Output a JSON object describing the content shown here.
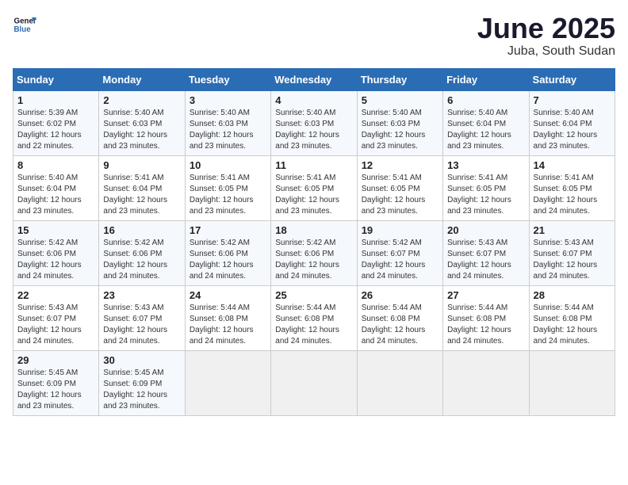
{
  "logo": {
    "line1": "General",
    "line2": "Blue"
  },
  "title": "June 2025",
  "location": "Juba, South Sudan",
  "weekdays": [
    "Sunday",
    "Monday",
    "Tuesday",
    "Wednesday",
    "Thursday",
    "Friday",
    "Saturday"
  ],
  "weeks": [
    [
      {
        "day": "1",
        "info": "Sunrise: 5:39 AM\nSunset: 6:02 PM\nDaylight: 12 hours\nand 22 minutes."
      },
      {
        "day": "2",
        "info": "Sunrise: 5:40 AM\nSunset: 6:03 PM\nDaylight: 12 hours\nand 23 minutes."
      },
      {
        "day": "3",
        "info": "Sunrise: 5:40 AM\nSunset: 6:03 PM\nDaylight: 12 hours\nand 23 minutes."
      },
      {
        "day": "4",
        "info": "Sunrise: 5:40 AM\nSunset: 6:03 PM\nDaylight: 12 hours\nand 23 minutes."
      },
      {
        "day": "5",
        "info": "Sunrise: 5:40 AM\nSunset: 6:03 PM\nDaylight: 12 hours\nand 23 minutes."
      },
      {
        "day": "6",
        "info": "Sunrise: 5:40 AM\nSunset: 6:04 PM\nDaylight: 12 hours\nand 23 minutes."
      },
      {
        "day": "7",
        "info": "Sunrise: 5:40 AM\nSunset: 6:04 PM\nDaylight: 12 hours\nand 23 minutes."
      }
    ],
    [
      {
        "day": "8",
        "info": "Sunrise: 5:40 AM\nSunset: 6:04 PM\nDaylight: 12 hours\nand 23 minutes."
      },
      {
        "day": "9",
        "info": "Sunrise: 5:41 AM\nSunset: 6:04 PM\nDaylight: 12 hours\nand 23 minutes."
      },
      {
        "day": "10",
        "info": "Sunrise: 5:41 AM\nSunset: 6:05 PM\nDaylight: 12 hours\nand 23 minutes."
      },
      {
        "day": "11",
        "info": "Sunrise: 5:41 AM\nSunset: 6:05 PM\nDaylight: 12 hours\nand 23 minutes."
      },
      {
        "day": "12",
        "info": "Sunrise: 5:41 AM\nSunset: 6:05 PM\nDaylight: 12 hours\nand 23 minutes."
      },
      {
        "day": "13",
        "info": "Sunrise: 5:41 AM\nSunset: 6:05 PM\nDaylight: 12 hours\nand 23 minutes."
      },
      {
        "day": "14",
        "info": "Sunrise: 5:41 AM\nSunset: 6:05 PM\nDaylight: 12 hours\nand 24 minutes."
      }
    ],
    [
      {
        "day": "15",
        "info": "Sunrise: 5:42 AM\nSunset: 6:06 PM\nDaylight: 12 hours\nand 24 minutes."
      },
      {
        "day": "16",
        "info": "Sunrise: 5:42 AM\nSunset: 6:06 PM\nDaylight: 12 hours\nand 24 minutes."
      },
      {
        "day": "17",
        "info": "Sunrise: 5:42 AM\nSunset: 6:06 PM\nDaylight: 12 hours\nand 24 minutes."
      },
      {
        "day": "18",
        "info": "Sunrise: 5:42 AM\nSunset: 6:06 PM\nDaylight: 12 hours\nand 24 minutes."
      },
      {
        "day": "19",
        "info": "Sunrise: 5:42 AM\nSunset: 6:07 PM\nDaylight: 12 hours\nand 24 minutes."
      },
      {
        "day": "20",
        "info": "Sunrise: 5:43 AM\nSunset: 6:07 PM\nDaylight: 12 hours\nand 24 minutes."
      },
      {
        "day": "21",
        "info": "Sunrise: 5:43 AM\nSunset: 6:07 PM\nDaylight: 12 hours\nand 24 minutes."
      }
    ],
    [
      {
        "day": "22",
        "info": "Sunrise: 5:43 AM\nSunset: 6:07 PM\nDaylight: 12 hours\nand 24 minutes."
      },
      {
        "day": "23",
        "info": "Sunrise: 5:43 AM\nSunset: 6:07 PM\nDaylight: 12 hours\nand 24 minutes."
      },
      {
        "day": "24",
        "info": "Sunrise: 5:44 AM\nSunset: 6:08 PM\nDaylight: 12 hours\nand 24 minutes."
      },
      {
        "day": "25",
        "info": "Sunrise: 5:44 AM\nSunset: 6:08 PM\nDaylight: 12 hours\nand 24 minutes."
      },
      {
        "day": "26",
        "info": "Sunrise: 5:44 AM\nSunset: 6:08 PM\nDaylight: 12 hours\nand 24 minutes."
      },
      {
        "day": "27",
        "info": "Sunrise: 5:44 AM\nSunset: 6:08 PM\nDaylight: 12 hours\nand 24 minutes."
      },
      {
        "day": "28",
        "info": "Sunrise: 5:44 AM\nSunset: 6:08 PM\nDaylight: 12 hours\nand 24 minutes."
      }
    ],
    [
      {
        "day": "29",
        "info": "Sunrise: 5:45 AM\nSunset: 6:09 PM\nDaylight: 12 hours\nand 23 minutes."
      },
      {
        "day": "30",
        "info": "Sunrise: 5:45 AM\nSunset: 6:09 PM\nDaylight: 12 hours\nand 23 minutes."
      },
      {
        "day": "",
        "info": ""
      },
      {
        "day": "",
        "info": ""
      },
      {
        "day": "",
        "info": ""
      },
      {
        "day": "",
        "info": ""
      },
      {
        "day": "",
        "info": ""
      }
    ]
  ]
}
